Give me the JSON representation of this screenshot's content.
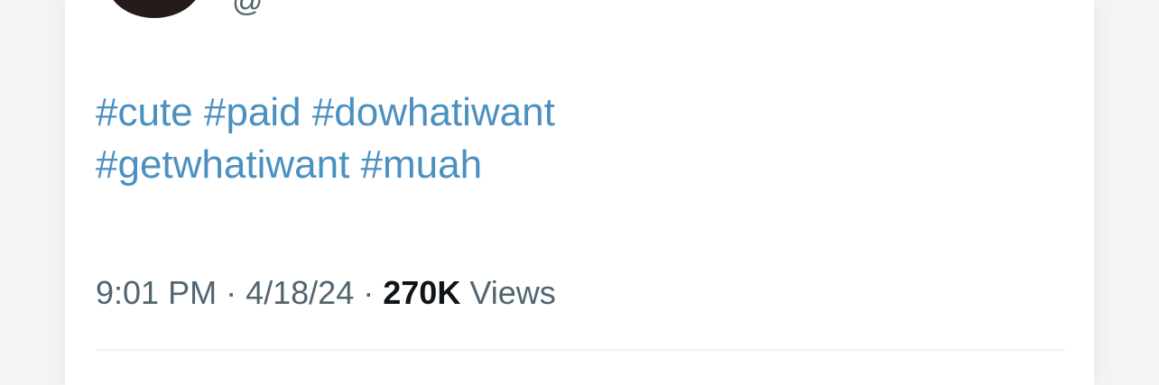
{
  "tweet": {
    "handle": "@",
    "hashtags": [
      "#cute",
      "#paid",
      "#dowhatiwant",
      "#getwhatiwant",
      "#muah"
    ],
    "time": "9:01 PM",
    "date": "4/18/24",
    "views_count": "270K",
    "views_label": "Views",
    "separator": "·"
  }
}
